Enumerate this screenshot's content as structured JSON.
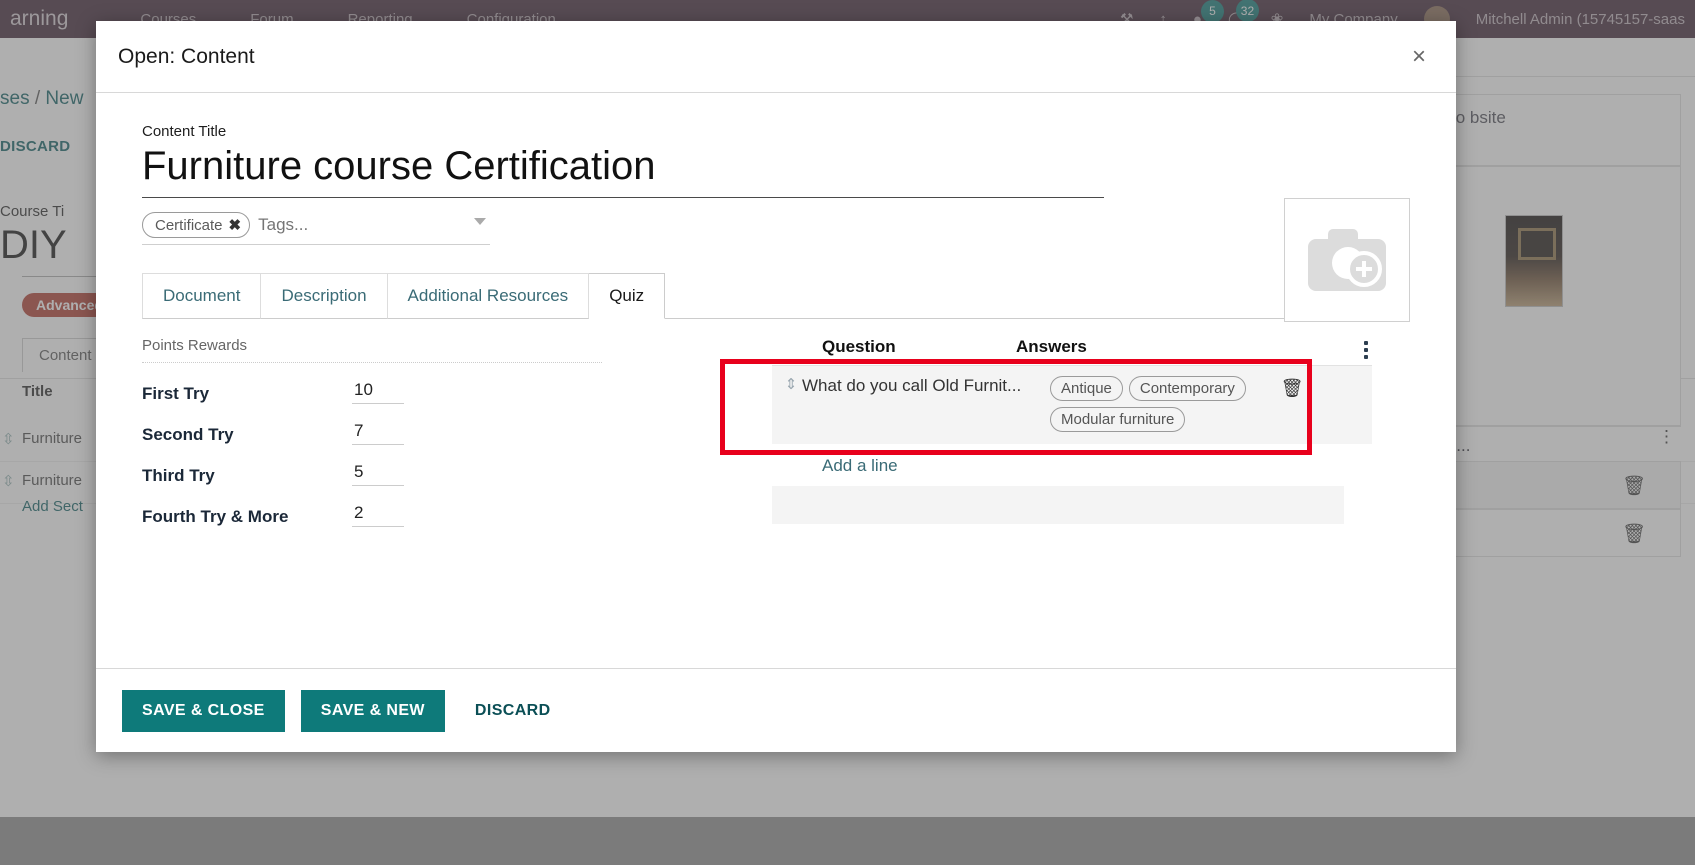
{
  "background": {
    "navbar": {
      "brand": "arning",
      "links": [
        "Courses",
        "Forum",
        "Reporting",
        "Configuration"
      ],
      "messages_badge": "5",
      "calls_badge": "32",
      "company": "My Company",
      "user": "Mitchell Admin (15745157-saas"
    },
    "breadcrumb_left": "ses",
    "breadcrumb_sep": "/",
    "breadcrumb_current": "New",
    "discard_label": "DISCARD",
    "course_title_label": "Course Ti",
    "course_title": "DIY",
    "course_tag": "Advanced",
    "content_tab": "Content",
    "table_header_title": "Title",
    "rows": [
      "Furniture",
      "Furniture"
    ],
    "add_section": "Add Sect",
    "right_card_text": "to\nbsite",
    "right_list_title": "is..."
  },
  "modal": {
    "title": "Open: Content",
    "close_icon": "close-icon",
    "content_title_label": "Content Title",
    "content_title_value": "Furniture course Certification",
    "tags": [
      {
        "label": "Certificate",
        "remove_icon": "✖"
      }
    ],
    "tags_placeholder": "Tags...",
    "image_placeholder_icon": "camera-add-icon",
    "tabs": [
      {
        "label": "Document",
        "active": false
      },
      {
        "label": "Description",
        "active": false
      },
      {
        "label": "Additional Resources",
        "active": false
      },
      {
        "label": "Quiz",
        "active": true
      }
    ],
    "quiz": {
      "rewards_heading": "Points Rewards",
      "rewards": [
        {
          "label": "First Try",
          "value": "10"
        },
        {
          "label": "Second Try",
          "value": "7"
        },
        {
          "label": "Third Try",
          "value": "5"
        },
        {
          "label": "Fourth Try & More",
          "value": "2"
        }
      ],
      "columns": {
        "question": "Question",
        "answers": "Answers"
      },
      "options_icon": "vertical-dots-icon",
      "rows": [
        {
          "drag_icon": "drag-handle-icon",
          "question": "What do you call Old Furnit...",
          "answers": [
            "Antique",
            "Contemporary",
            "Modular furniture"
          ],
          "delete_icon": "trash-icon"
        }
      ],
      "add_line_label": "Add a line"
    },
    "footer": {
      "save_close": "SAVE & CLOSE",
      "save_new": "SAVE & NEW",
      "discard": "DISCARD"
    }
  },
  "highlight_color": "#e8001c",
  "accent_color": "#0e7a7a"
}
